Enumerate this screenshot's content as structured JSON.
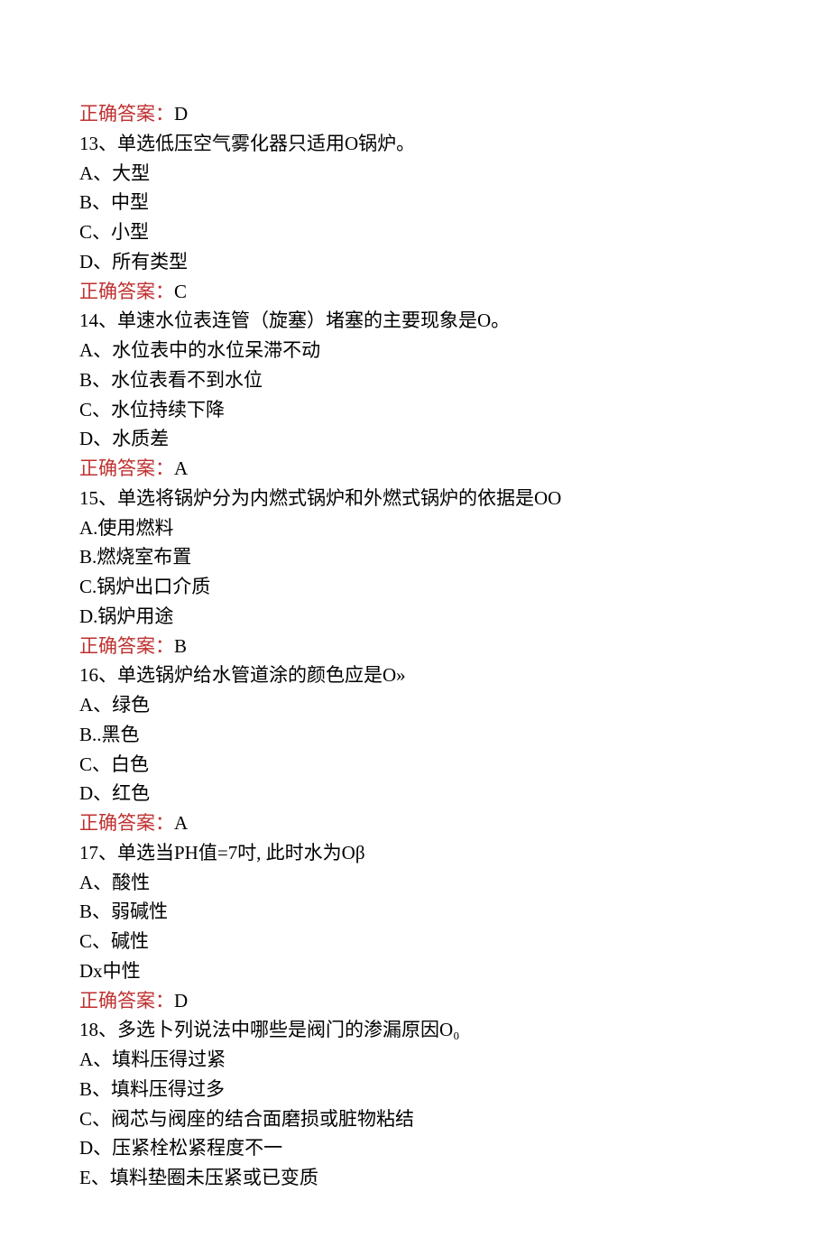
{
  "q12": {
    "answer_label": "正确答案：",
    "answer_value": "D"
  },
  "q13": {
    "stem": "13、单选低压空气雾化器只适用O锅炉。",
    "optA": "A、大型",
    "optB": "B、中型",
    "optC": "C、小型",
    "optD": "D、所有类型",
    "answer_label": "正确答案：",
    "answer_value": "C"
  },
  "q14": {
    "stem": "14、单速水位表连管（旋塞）堵塞的主要现象是O。",
    "optA": "A、水位表中的水位呆滞不动",
    "optB": "B、水位表看不到水位",
    "optC": "C、水位持续下降",
    "optD": "D、水质差",
    "answer_label": "正确答案：",
    "answer_value": "A"
  },
  "q15": {
    "stem": "15、单选将锅炉分为内燃式锅炉和外燃式锅炉的依据是OO",
    "optA": "A.使用燃料",
    "optB": "B.燃烧室布置",
    "optC": "C.锅炉出口介质",
    "optD": "D.锅炉用途",
    "answer_label": "正确答案：",
    "answer_value": "B"
  },
  "q16": {
    "stem": "16、单选锅炉给水管道涂的颜色应是O»",
    "optA": "A、绿色",
    "optB": "B..黑色",
    "optC": "C、白色",
    "optD": "D、红色",
    "answer_label": "正确答案：",
    "answer_value": "A"
  },
  "q17": {
    "stem": "17、单选当PH值=7吋, 此时水为Oβ",
    "optA": "A、酸性",
    "optB": "B、弱碱性",
    "optC": "C、碱性",
    "optD": "Dx中性",
    "answer_label": "正确答案：",
    "answer_value": "D"
  },
  "q18": {
    "stem": "18、多选卜列说法中哪些是阀门的渗漏原因O₀",
    "optA": "A、填料压得过紧",
    "optB": "B、填料压得过多",
    "optC": "C、阀芯与阀座的结合面磨损或脏物粘结",
    "optD": "D、压紧栓松紧程度不一",
    "optE": "E、填料垫圈未压紧或已变质"
  }
}
